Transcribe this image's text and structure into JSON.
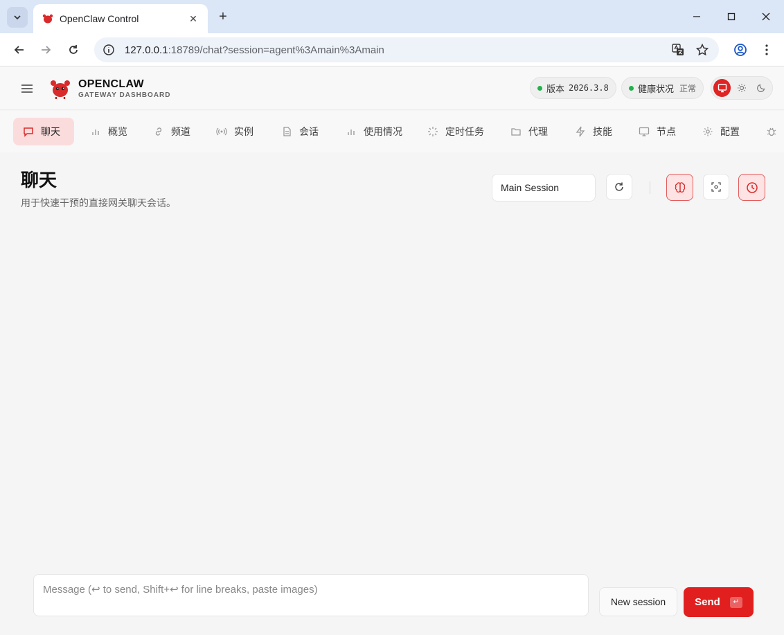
{
  "browser": {
    "tab_title": "OpenClaw Control",
    "url_host": "127.0.0.1",
    "url_rest": ":18789/chat?session=agent%3Amain%3Amain"
  },
  "header": {
    "brand_title": "OPENCLAW",
    "brand_sub": "GATEWAY DASHBOARD",
    "version_label": "版本",
    "version_value": "2026.3.8",
    "health_label": "健康状况",
    "health_value": "正常"
  },
  "nav": {
    "items": [
      {
        "label": "聊天",
        "icon": "chat-icon"
      },
      {
        "label": "概览",
        "icon": "bar-chart-icon"
      },
      {
        "label": "频道",
        "icon": "link-icon"
      },
      {
        "label": "实例",
        "icon": "radio-icon"
      },
      {
        "label": "会话",
        "icon": "document-icon"
      },
      {
        "label": "使用情况",
        "icon": "bar-chart-icon"
      },
      {
        "label": "定时任务",
        "icon": "loader-icon"
      },
      {
        "label": "代理",
        "icon": "folder-icon"
      },
      {
        "label": "技能",
        "icon": "lightning-icon"
      },
      {
        "label": "节点",
        "icon": "monitor-icon"
      },
      {
        "label": "配置",
        "icon": "gear-icon"
      }
    ]
  },
  "page": {
    "title": "聊天",
    "subtitle": "用于快速干预的直接网关聊天会话。",
    "session_select": "Main Session"
  },
  "composer": {
    "placeholder": "Message (↩ to send, Shift+↩ for line breaks, paste images)",
    "new_session": "New session",
    "send": "Send",
    "send_kbd": "↵"
  },
  "colors": {
    "accent": "#e21f1f",
    "accent_soft": "#fbdcdc",
    "status_ok": "#22b14c"
  }
}
